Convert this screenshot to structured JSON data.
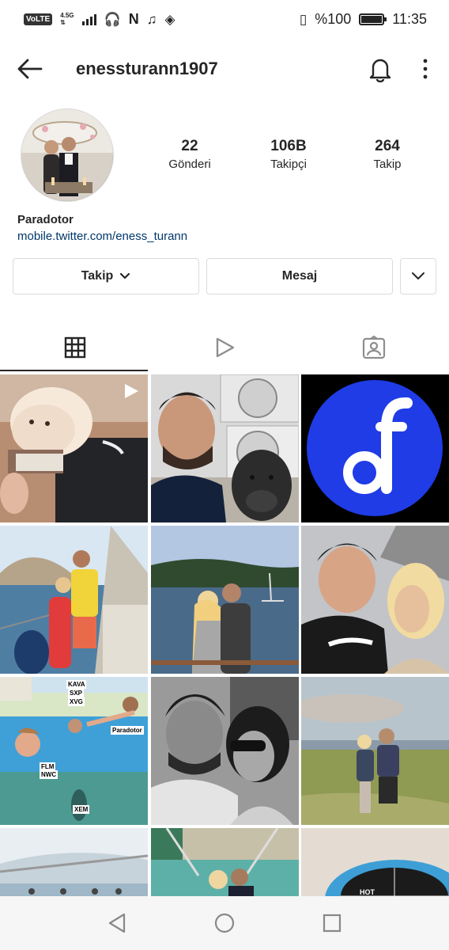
{
  "status_bar": {
    "volte": "VoLTE",
    "network_type": "4.5G",
    "battery_text": "%100",
    "battery_level": 1.0,
    "time": "11:35"
  },
  "header": {
    "username": "enessturann1907"
  },
  "profile": {
    "stats": [
      {
        "value": "22",
        "label": "Gönderi"
      },
      {
        "value": "106B",
        "label": "Takipçi"
      },
      {
        "value": "264",
        "label": "Takip"
      }
    ],
    "bio_name": "Paradotor",
    "bio_link": "mobile.twitter.com/eness_turann"
  },
  "buttons": {
    "follow_label": "Takip",
    "message_label": "Mesaj"
  },
  "tabs": [
    {
      "icon": "grid-icon",
      "active": true
    },
    {
      "icon": "reels-icon",
      "active": false
    },
    {
      "icon": "tagged-icon",
      "active": false
    }
  ],
  "posts": [
    {
      "id": 1,
      "reel": true
    },
    {
      "id": 2
    },
    {
      "id": 3
    },
    {
      "id": 4
    },
    {
      "id": 5
    },
    {
      "id": 6
    },
    {
      "id": 7,
      "tags": [
        "KAVA",
        "SXP",
        "XVG",
        "Paradotor",
        "FLM",
        "NWC",
        "XEM"
      ]
    },
    {
      "id": 8
    },
    {
      "id": 9
    },
    {
      "id": 10
    },
    {
      "id": 11
    },
    {
      "id": 12,
      "cake_text": "HOT"
    }
  ],
  "nav": {
    "icons": [
      "back-triangle-icon",
      "home-circle-icon",
      "recents-square-icon"
    ]
  },
  "colors": {
    "link": "#00376b",
    "text": "#262626",
    "border": "#dbdbdb",
    "logo_blue": "#1f3ce6"
  }
}
